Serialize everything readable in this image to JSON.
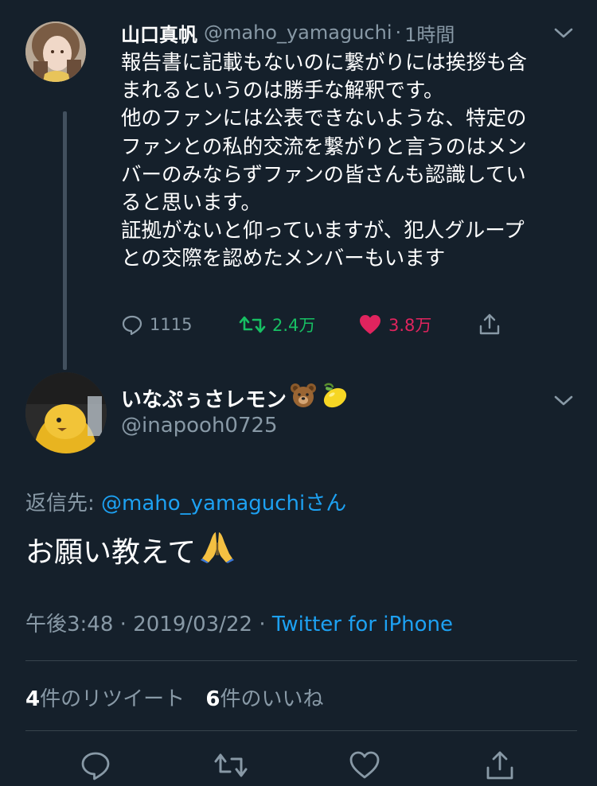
{
  "parent_tweet": {
    "name": "山口真帆",
    "handle": "@maho_yamaguchi",
    "separator": "·",
    "time": "1時間",
    "body_lines": [
      "報告書に記載もないのに繋がりには挨拶も含",
      "まれるというのは勝手な解釈です。",
      "他のファンには公表できないような、特定の",
      "ファンとの私的交流を繋がりと言うのはメン",
      "バーのみならずファンの皆さんも認識してい",
      "ると思います。",
      "証拠がないと仰っていますが、犯人グループ",
      "との交際を認めたメンバーもいます"
    ],
    "actions": {
      "reply_count": "1115",
      "retweet_count": "2.4万",
      "like_count": "3.8万"
    }
  },
  "reply_tweet": {
    "name": "いなぷぅさレモン",
    "name_emojis": [
      "bear-face-emoji",
      "lemon-emoji"
    ],
    "handle": "@inapooh0725",
    "reply_to_label": "返信先: ",
    "reply_to_mention": "@maho_yamaguchi",
    "reply_to_suffix": "さん",
    "text": "お願い教えて",
    "text_emoji": "folded-hands-emoji",
    "time": "午後3:48",
    "date_separator": "·",
    "date": "2019/03/22",
    "source_separator": "·",
    "source": "Twitter for iPhone",
    "retweets_count": "4",
    "retweets_label": "件のリツイート",
    "likes_count": "6",
    "likes_label": "件のいいね"
  },
  "colors": {
    "background": "#15202b",
    "text": "#ffffff",
    "muted": "#8899a6",
    "link": "#1da1f2",
    "retweet_green": "#17bf63",
    "like_red": "#e0245e",
    "divider": "#38444d"
  }
}
